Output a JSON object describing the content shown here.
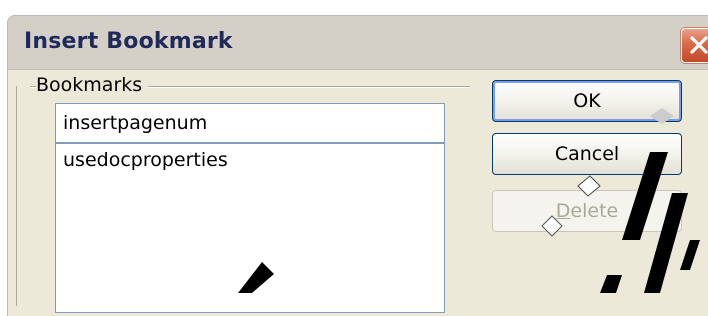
{
  "dialog": {
    "title": "Insert Bookmark",
    "group_label": "Bookmarks",
    "name_value": "insertpagenum",
    "bookmarks": [
      "usedocproperties"
    ]
  },
  "buttons": {
    "ok": "OK",
    "cancel": "Cancel",
    "delete_first": "D",
    "delete_rest": "elete"
  },
  "colors": {
    "dialog_bg": "#ece9d8",
    "title_text": "#1f2a5a",
    "close_red": "#d76a4a",
    "button_border": "#003c74"
  },
  "icons": {
    "close": "close-icon"
  }
}
